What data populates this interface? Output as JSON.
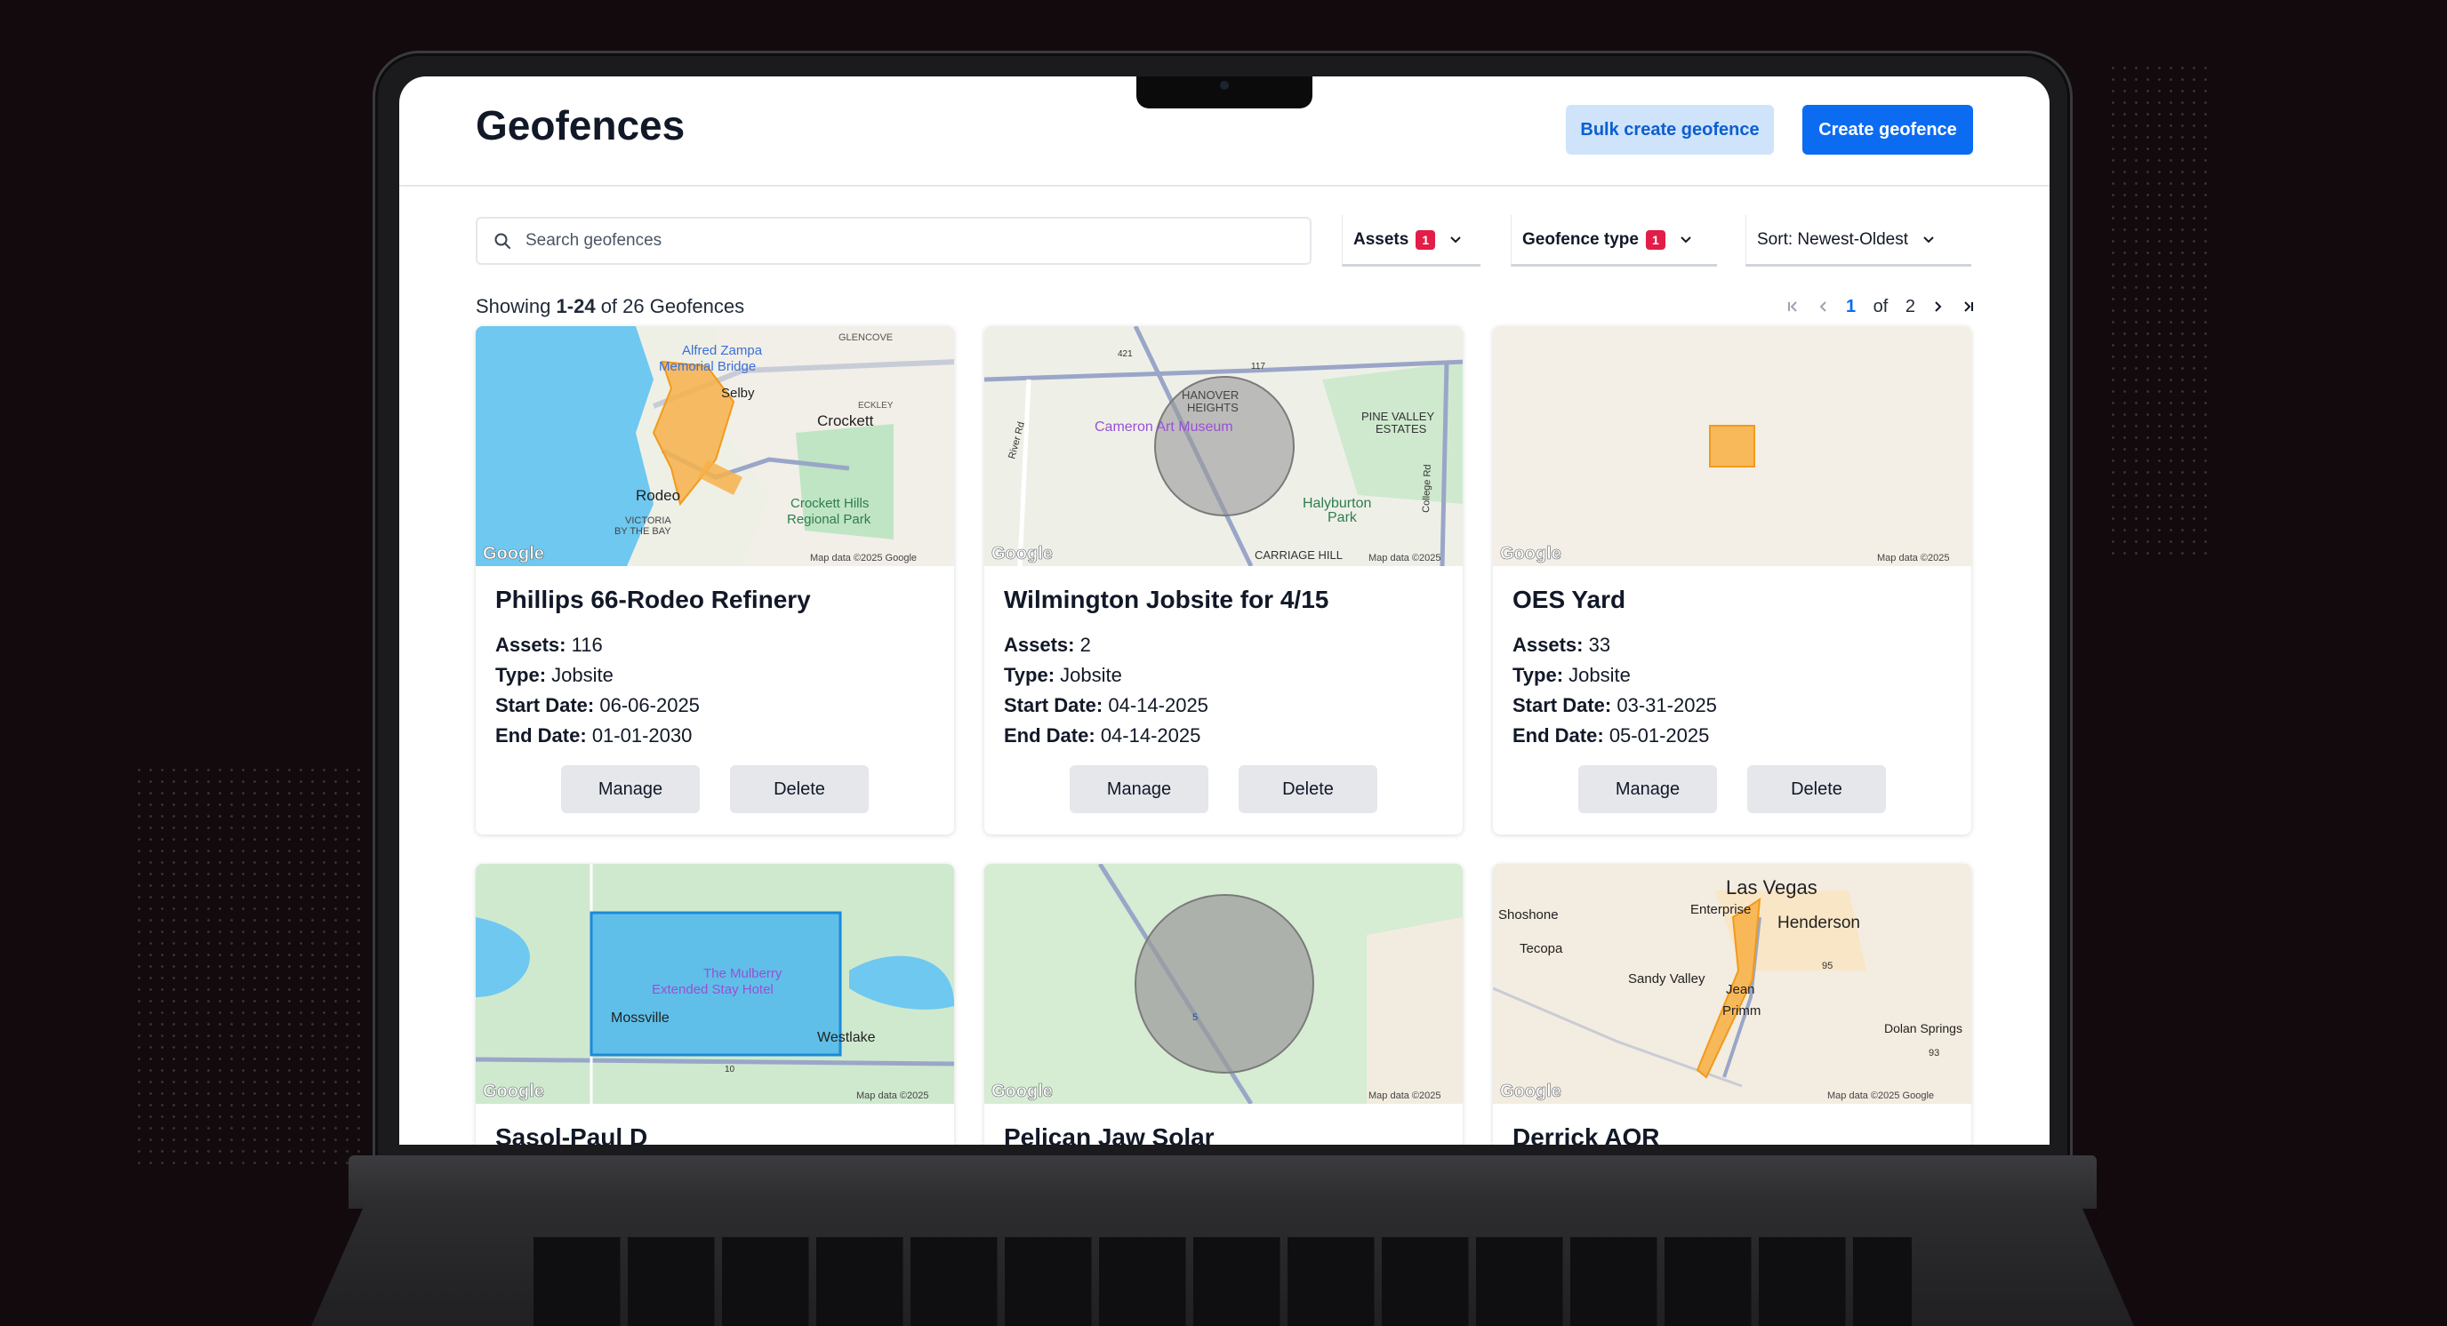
{
  "header": {
    "title": "Geofences",
    "bulk_create_label": "Bulk create geofence",
    "create_label": "Create geofence"
  },
  "search": {
    "placeholder": "Search geofences"
  },
  "filters": {
    "assets": {
      "label": "Assets",
      "count": "1"
    },
    "type": {
      "label": "Geofence type",
      "count": "1"
    },
    "sort": {
      "label": "Sort: Newest-Oldest"
    }
  },
  "summary": {
    "prefix": "Showing",
    "range": "1-24",
    "suffix": "of 26 Geofences"
  },
  "pagination": {
    "current": "1",
    "of_label": "of",
    "total": "2"
  },
  "labels": {
    "assets": "Assets:",
    "type": "Type:",
    "start": "Start Date:",
    "end": "End Date:",
    "manage": "Manage",
    "delete": "Delete"
  },
  "cards": [
    {
      "title": "Phillips 66-Rodeo Refinery",
      "assets": "116",
      "type": "Jobsite",
      "start": "06-06-2025",
      "end": "01-01-2030",
      "map": {
        "places": [
          "Alfred Zampa",
          "Memorial Bridge",
          "GLENCOVE",
          "Selby",
          "ECKLEY",
          "Crockett",
          "Rodeo",
          "VICTORIA",
          "BY THE BAY",
          "Crockett Hills",
          "Regional Park"
        ],
        "attribution": "Map data ©2025 Google"
      }
    },
    {
      "title": "Wilmington Jobsite for 4/15",
      "assets": "2",
      "type": "Jobsite",
      "start": "04-14-2025",
      "end": "04-14-2025",
      "map": {
        "places": [
          "HANOVER",
          "HEIGHTS",
          "Cameron Art Museum",
          "PINE VALLEY",
          "ESTATES",
          "Halyburton",
          "Park",
          "CARRIAGE HILL",
          "River Rd",
          "College Rd",
          "421",
          "117"
        ],
        "attribution": "Map data ©2025"
      }
    },
    {
      "title": "OES Yard",
      "assets": "33",
      "type": "Jobsite",
      "start": "03-31-2025",
      "end": "05-01-2025",
      "map": {
        "places": [],
        "attribution": "Map data ©2025"
      }
    },
    {
      "title": "Sasol-Paul D",
      "map": {
        "places": [
          "The Mulberry",
          "Extended Stay Hotel",
          "Mossville",
          "Westlake",
          "10"
        ],
        "attribution": "Map data ©2025"
      }
    },
    {
      "title": "Pelican Jaw Solar",
      "map": {
        "places": [
          "5"
        ],
        "attribution": "Map data ©2025"
      }
    },
    {
      "title": "Derrick AOR",
      "map": {
        "places": [
          "Las Vegas",
          "Shoshone",
          "Enterprise",
          "Henderson",
          "Tecopa",
          "Sandy Valley",
          "Jean",
          "Primm",
          "Dolan Springs",
          "95",
          "93"
        ],
        "attribution": "Map data ©2025 Google"
      }
    }
  ],
  "map_brand": "Google",
  "colors": {
    "primary": "#0b6cf2",
    "primary_soft": "#cfe3fb",
    "badge": "#e11d48",
    "geofence": "#f7b24a",
    "water": "#6ec8f0"
  }
}
